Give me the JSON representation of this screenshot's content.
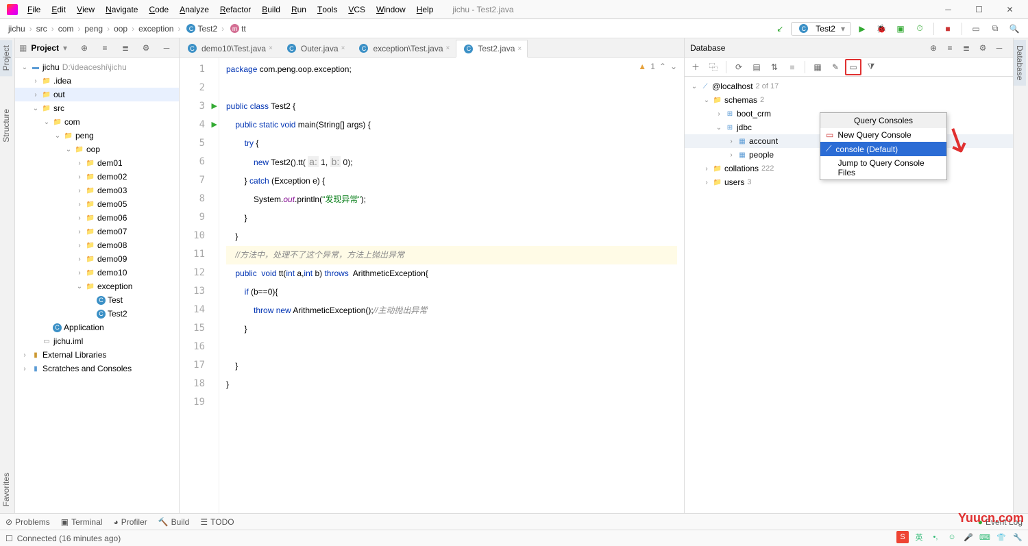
{
  "window": {
    "title": "jichu - Test2.java"
  },
  "menubar": [
    "File",
    "Edit",
    "View",
    "Navigate",
    "Code",
    "Analyze",
    "Refactor",
    "Build",
    "Run",
    "Tools",
    "VCS",
    "Window",
    "Help"
  ],
  "breadcrumbs": [
    {
      "label": "jichu",
      "icon": "module"
    },
    {
      "label": "src",
      "icon": "folder"
    },
    {
      "label": "com",
      "icon": "folder"
    },
    {
      "label": "peng",
      "icon": "folder"
    },
    {
      "label": "oop",
      "icon": "folder"
    },
    {
      "label": "exception",
      "icon": "folder"
    },
    {
      "label": "Test2",
      "icon": "class"
    },
    {
      "label": "tt",
      "icon": "method"
    }
  ],
  "run_config": "Test2",
  "project_panel": {
    "title": "Project",
    "tree": [
      {
        "depth": 0,
        "arrow": "v",
        "icon": "module",
        "label": "jichu",
        "hint": "D:\\ideaceshi\\jichu"
      },
      {
        "depth": 1,
        "arrow": ">",
        "icon": "folder",
        "label": ".idea"
      },
      {
        "depth": 1,
        "arrow": ">",
        "icon": "out",
        "label": "out",
        "sel": true
      },
      {
        "depth": 1,
        "arrow": "v",
        "icon": "src",
        "label": "src"
      },
      {
        "depth": 2,
        "arrow": "v",
        "icon": "folder",
        "label": "com"
      },
      {
        "depth": 3,
        "arrow": "v",
        "icon": "folder",
        "label": "peng"
      },
      {
        "depth": 4,
        "arrow": "v",
        "icon": "folder",
        "label": "oop"
      },
      {
        "depth": 5,
        "arrow": ">",
        "icon": "folder",
        "label": "dem01"
      },
      {
        "depth": 5,
        "arrow": ">",
        "icon": "folder",
        "label": "demo02"
      },
      {
        "depth": 5,
        "arrow": ">",
        "icon": "folder",
        "label": "demo03"
      },
      {
        "depth": 5,
        "arrow": ">",
        "icon": "folder",
        "label": "demo05"
      },
      {
        "depth": 5,
        "arrow": ">",
        "icon": "folder",
        "label": "demo06"
      },
      {
        "depth": 5,
        "arrow": ">",
        "icon": "folder",
        "label": "demo07"
      },
      {
        "depth": 5,
        "arrow": ">",
        "icon": "folder",
        "label": "demo08"
      },
      {
        "depth": 5,
        "arrow": ">",
        "icon": "folder",
        "label": "demo09"
      },
      {
        "depth": 5,
        "arrow": ">",
        "icon": "folder",
        "label": "demo10"
      },
      {
        "depth": 5,
        "arrow": "v",
        "icon": "folder",
        "label": "exception"
      },
      {
        "depth": 6,
        "arrow": "",
        "icon": "class",
        "label": "Test"
      },
      {
        "depth": 6,
        "arrow": "",
        "icon": "class",
        "label": "Test2"
      },
      {
        "depth": 2,
        "arrow": "",
        "icon": "class",
        "label": "Application"
      },
      {
        "depth": 1,
        "arrow": "",
        "icon": "file",
        "label": "jichu.iml"
      },
      {
        "depth": 0,
        "arrow": ">",
        "icon": "lib",
        "label": "External Libraries"
      },
      {
        "depth": 0,
        "arrow": ">",
        "icon": "scratch",
        "label": "Scratches and Consoles"
      }
    ]
  },
  "tabs": [
    {
      "label": "demo10\\Test.java",
      "icon": "class",
      "active": false
    },
    {
      "label": "Outer.java",
      "icon": "class",
      "active": false
    },
    {
      "label": "exception\\Test.java",
      "icon": "class",
      "active": false
    },
    {
      "label": "Test2.java",
      "icon": "class",
      "active": true
    }
  ],
  "editor": {
    "warnings": "1",
    "lines": [
      {
        "n": 1,
        "html": "<span class='kw'>package</span> com.peng.oop.exception;"
      },
      {
        "n": 2,
        "html": ""
      },
      {
        "n": 3,
        "html": "<span class='kw'>public class</span> Test2 {",
        "run": true
      },
      {
        "n": 4,
        "html": "    <span class='kw'>public static void</span> main(String[] args) {",
        "run": true
      },
      {
        "n": 5,
        "html": "        <span class='kw'>try</span> {"
      },
      {
        "n": 6,
        "html": "            <span class='kw'>new</span> Test2().tt( <span class='hint'>a:</span> 1, <span class='hint'>b:</span> 0);"
      },
      {
        "n": 7,
        "html": "        } <span class='kw'>catch</span> (Exception e) {"
      },
      {
        "n": 8,
        "html": "            System.<span style='color:#871094;font-style:italic'>out</span>.println(<span class='str'>\"发现异常\"</span>);"
      },
      {
        "n": 9,
        "html": "        }"
      },
      {
        "n": 10,
        "html": "    }"
      },
      {
        "n": 11,
        "html": "    <span class='cm'>//方法中，处理不了这个异常，方法上抛出异常</span>",
        "hl": true
      },
      {
        "n": 12,
        "html": "    <span class='kw'>public</span>  <span class='kw'>void</span> tt(<span class='kw'>int</span> a,<span class='kw'>int</span> b) <span class='kw'>throws</span>  ArithmeticException{"
      },
      {
        "n": 13,
        "html": "        <span class='kw'>if</span> (b==0){"
      },
      {
        "n": 14,
        "html": "            <span class='kw'>throw new</span> ArithmeticException();<span class='cm'>//主动抛出异常</span>"
      },
      {
        "n": 15,
        "html": "        }"
      },
      {
        "n": 16,
        "html": ""
      },
      {
        "n": 17,
        "html": "    }"
      },
      {
        "n": 18,
        "html": "}"
      },
      {
        "n": 19,
        "html": ""
      }
    ]
  },
  "database": {
    "title": "Database",
    "tree": [
      {
        "depth": 0,
        "arrow": "v",
        "icon": "ds",
        "label": "@localhost",
        "hint": "2 of 17"
      },
      {
        "depth": 1,
        "arrow": "v",
        "icon": "folder",
        "label": "schemas",
        "hint": "2"
      },
      {
        "depth": 2,
        "arrow": ">",
        "icon": "schema",
        "label": "boot_crm"
      },
      {
        "depth": 2,
        "arrow": "v",
        "icon": "schema",
        "label": "jdbc"
      },
      {
        "depth": 3,
        "arrow": ">",
        "icon": "table",
        "label": "account",
        "sel": true
      },
      {
        "depth": 3,
        "arrow": ">",
        "icon": "table",
        "label": "people"
      },
      {
        "depth": 1,
        "arrow": ">",
        "icon": "folder",
        "label": "collations",
        "hint": "222"
      },
      {
        "depth": 1,
        "arrow": ">",
        "icon": "folder",
        "label": "users",
        "hint": "3"
      }
    ],
    "popup": {
      "title": "Query Consoles",
      "items": [
        {
          "label": "New Query Console",
          "icon": "new",
          "sel": false
        },
        {
          "label": "console (Default)",
          "icon": "console",
          "sel": true
        },
        {
          "label": "Jump to Query Console Files",
          "icon": "",
          "sel": false
        }
      ]
    }
  },
  "left_tabs": [
    "Project",
    "Structure",
    "Favorites"
  ],
  "right_tabs": [
    "Database"
  ],
  "bottom_bar": [
    "Problems",
    "Terminal",
    "Profiler",
    "Build",
    "TODO"
  ],
  "status": {
    "left": "Connected (16 minutes ago)",
    "event_log": "Event Log"
  },
  "watermark": "Yuucn.com"
}
